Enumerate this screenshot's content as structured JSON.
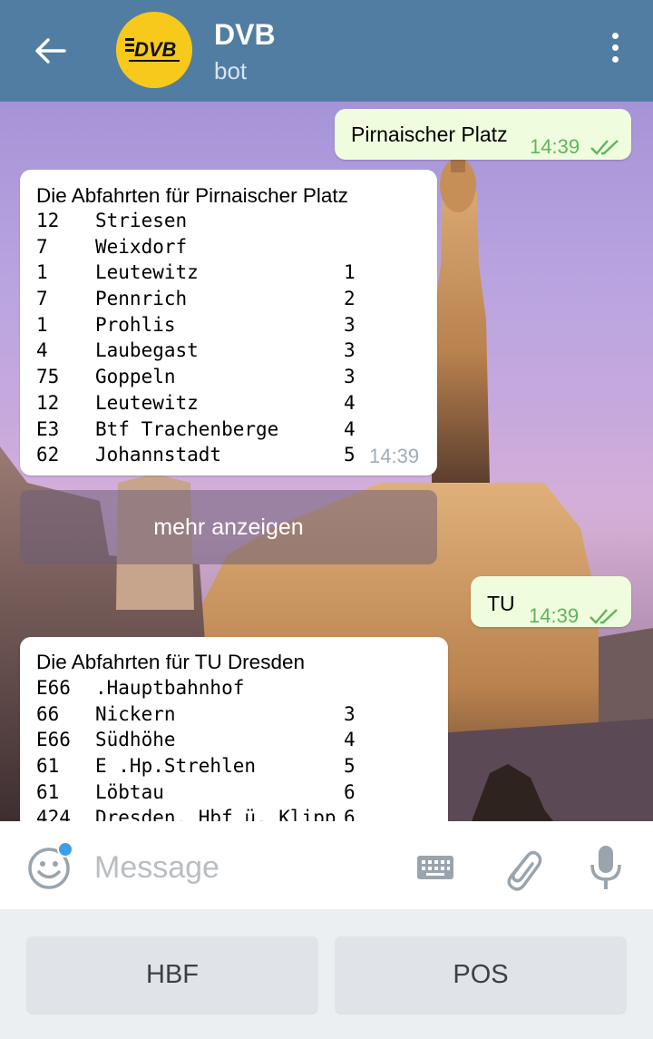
{
  "header": {
    "title": "DVB",
    "subtitle": "bot",
    "avatar_text": "DVB",
    "accent_color": "#517da2"
  },
  "messages": {
    "out1": {
      "text": "Pirnaischer Platz",
      "time": "14:39",
      "status": "read"
    },
    "in1": {
      "title": "Die Abfahrten für Pirnaischer Platz",
      "time": "14:39",
      "rows": [
        {
          "line": "12",
          "dest": "Striesen",
          "mins": ""
        },
        {
          "line": "7",
          "dest": "Weixdorf",
          "mins": ""
        },
        {
          "line": "1",
          "dest": "Leutewitz",
          "mins": "1"
        },
        {
          "line": "7",
          "dest": "Pennrich",
          "mins": "2"
        },
        {
          "line": "1",
          "dest": "Prohlis",
          "mins": "3"
        },
        {
          "line": "4",
          "dest": "Laubegast",
          "mins": "3"
        },
        {
          "line": "75",
          "dest": "Goppeln",
          "mins": "3"
        },
        {
          "line": "12",
          "dest": "Leutewitz",
          "mins": "4"
        },
        {
          "line": "E3",
          "dest": "Btf Trachenberge",
          "mins": "4"
        },
        {
          "line": "62",
          "dest": "Johannstadt",
          "mins": "5"
        }
      ]
    },
    "more_button": "mehr anzeigen",
    "out2": {
      "text": "TU",
      "time": "14:39",
      "status": "read"
    },
    "in2": {
      "title": "Die Abfahrten für TU Dresden",
      "rows": [
        {
          "line": "E66",
          "dest": ".Hauptbahnhof",
          "mins": ""
        },
        {
          "line": "66",
          "dest": "Nickern",
          "mins": "3"
        },
        {
          "line": "E66",
          "dest": "Südhöhe",
          "mins": "4"
        },
        {
          "line": "61",
          "dest": "E .Hp.Strehlen",
          "mins": "5"
        },
        {
          "line": "61",
          "dest": "Löbtau",
          "mins": "6"
        },
        {
          "line": "424",
          "dest": "Dresden, Hbf ü. Klipp",
          "mins": "6"
        }
      ]
    }
  },
  "input": {
    "placeholder": "Message"
  },
  "keyboard": {
    "buttons": [
      "HBF",
      "POS"
    ]
  }
}
